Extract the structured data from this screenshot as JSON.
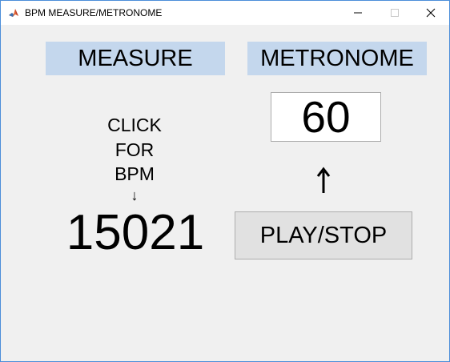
{
  "window": {
    "title": "BPM MEASURE/METRONOME",
    "icon": "matlab-logo-icon",
    "controls": [
      "minimize-icon",
      "maximize-icon",
      "close-icon"
    ]
  },
  "measure": {
    "label": "MEASURE",
    "instruction_lines": [
      "CLICK",
      "FOR",
      "BPM"
    ],
    "arrow": "↓",
    "bpm_value": "15021"
  },
  "metronome": {
    "label": "METRONOME",
    "tempo_value": "60",
    "arrow_icon": "up-arrow-icon",
    "play_label": "PLAY/STOP"
  },
  "colors": {
    "label_bg": "#c4d7ed",
    "window_bg": "#f0f0f0",
    "button_bg": "#e1e1e1"
  }
}
